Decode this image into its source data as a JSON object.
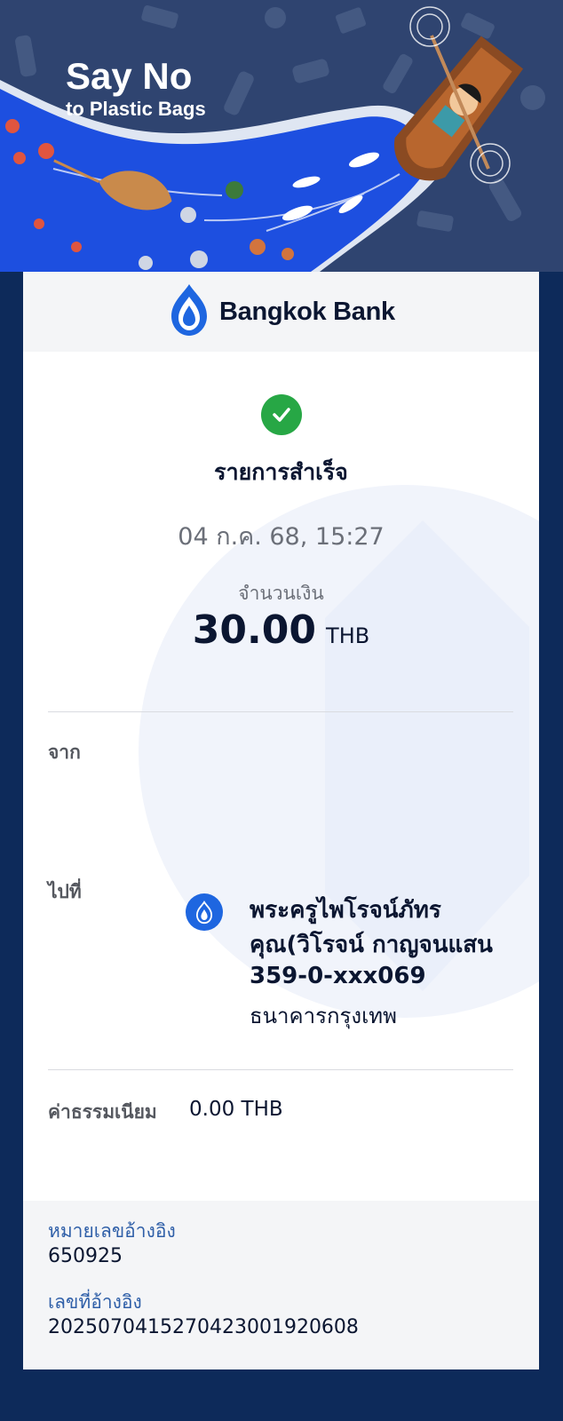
{
  "banner": {
    "title": "Say No",
    "subtitle": "to Plastic Bags"
  },
  "header": {
    "bank_name": "Bangkok Bank",
    "logo_icon": "bangkok-bank-lotus-icon",
    "brand_color": "#1e66e0"
  },
  "transaction": {
    "status_icon": "check-circle-icon",
    "status": "รายการสำเร็จ",
    "datetime": "04 ก.ค. 68, 15:27",
    "amount_label": "จำนวนเงิน",
    "amount": "30.00",
    "currency": "THB",
    "status_color": "#27a745"
  },
  "from": {
    "label": "จาก"
  },
  "to": {
    "label": "ไปที่",
    "name_line1": "พระครูไพโรจน์ภัทร",
    "name_line2": "คุณ(วิโรจน์ กาญจนแสน",
    "account": "359-0-xxx069",
    "bank": "ธนาคารกรุงเทพ"
  },
  "fee": {
    "label": "ค่าธรรมเนียม",
    "value": "0.00 THB"
  },
  "references": {
    "ref1_label": "หมายเลขอ้างอิง",
    "ref1_value": "650925",
    "ref2_label": "เลขที่อ้างอิง",
    "ref2_value": "2025070415270423001920608"
  }
}
